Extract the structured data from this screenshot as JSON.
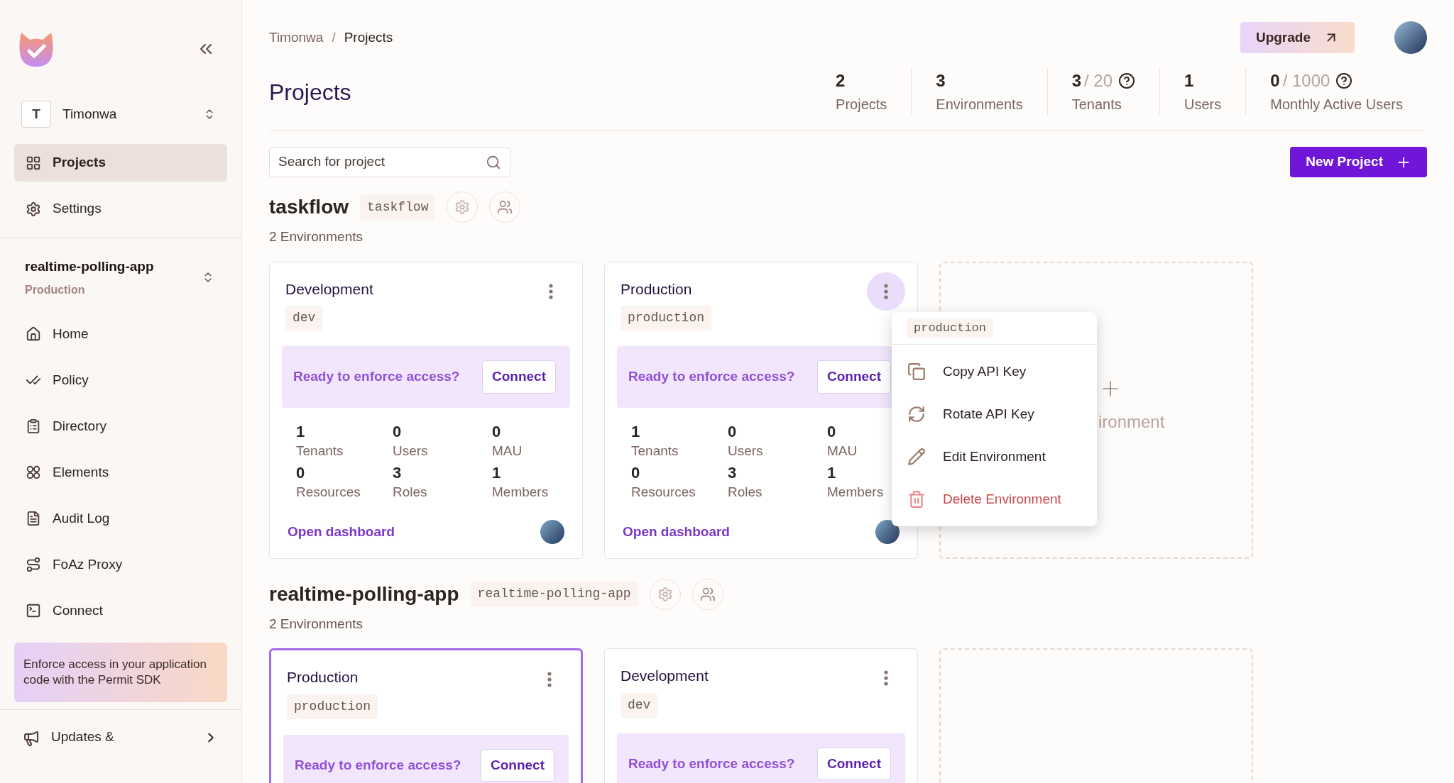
{
  "sidebar": {
    "org": {
      "initial": "T",
      "name": "Timonwa"
    },
    "org_items": [
      {
        "label": "Projects",
        "selected": true
      },
      {
        "label": "Settings",
        "selected": false
      }
    ],
    "project": {
      "name": "realtime-polling-app",
      "environment": "Production"
    },
    "project_items": [
      {
        "label": "Home",
        "selected": false
      },
      {
        "label": "Policy",
        "selected": false
      },
      {
        "label": "Directory",
        "selected": false
      },
      {
        "label": "Elements",
        "selected": false
      },
      {
        "label": "Audit Log",
        "selected": false
      },
      {
        "label": "FoAz Proxy",
        "selected": false
      },
      {
        "label": "Connect",
        "selected": false
      }
    ],
    "promo": "Enforce access in your application code with the Permit SDK",
    "updates": "Updates &"
  },
  "header": {
    "breadcrumb": [
      "Timonwa",
      "Projects"
    ],
    "separator": "/",
    "upgrade": "Upgrade"
  },
  "page_title": "Projects",
  "stats": [
    {
      "value": "2",
      "label": "Projects"
    },
    {
      "value": "3",
      "label": "Environments"
    },
    {
      "value": "3",
      "limit": "/ 20",
      "label": "Tenants",
      "help": true
    },
    {
      "value": "1",
      "label": "Users"
    },
    {
      "value": "0",
      "limit": "/ 1000",
      "label": "Monthly Active Users",
      "help": true
    }
  ],
  "search": {
    "placeholder": "Search for project"
  },
  "new_project": "New Project",
  "projects": [
    {
      "name": "taskflow",
      "slug": "taskflow",
      "env_count": "2 Environments",
      "add_label": "ironment",
      "environments": [
        {
          "name": "Development",
          "slug": "dev",
          "selected": false,
          "menu_open": false,
          "banner": "Ready to enforce access?",
          "connect": "Connect",
          "metrics": [
            {
              "value": "1",
              "label": "Tenants"
            },
            {
              "value": "0",
              "label": "Users"
            },
            {
              "value": "0",
              "label": "MAU"
            },
            {
              "value": "0",
              "label": "Resources"
            },
            {
              "value": "3",
              "label": "Roles"
            },
            {
              "value": "1",
              "label": "Members"
            }
          ],
          "link": "Open dashboard"
        },
        {
          "name": "Production",
          "slug": "production",
          "selected": false,
          "menu_open": true,
          "banner": "Ready to enforce access?",
          "connect": "Connect",
          "metrics": [
            {
              "value": "1",
              "label": "Tenants"
            },
            {
              "value": "0",
              "label": "Users"
            },
            {
              "value": "0",
              "label": "MAU"
            },
            {
              "value": "0",
              "label": "Resources"
            },
            {
              "value": "3",
              "label": "Roles"
            },
            {
              "value": "1",
              "label": "Members"
            }
          ],
          "link": "Open dashboard"
        }
      ]
    },
    {
      "name": "realtime-polling-app",
      "slug": "realtime-polling-app",
      "env_count": "2 Environments",
      "environments": [
        {
          "name": "Production",
          "slug": "production",
          "selected": true,
          "menu_open": false,
          "banner": "Ready to enforce access?",
          "connect": "Connect"
        },
        {
          "name": "Development",
          "slug": "dev",
          "selected": false,
          "menu_open": false,
          "banner": "Ready to enforce access?",
          "connect": "Connect"
        }
      ]
    }
  ],
  "env_menu": {
    "slug": "production",
    "items": [
      {
        "label": "Copy API Key",
        "kind": "normal"
      },
      {
        "label": "Rotate API Key",
        "kind": "normal"
      },
      {
        "label": "Edit Environment",
        "kind": "normal"
      },
      {
        "label": "Delete Environment",
        "kind": "danger"
      }
    ]
  }
}
